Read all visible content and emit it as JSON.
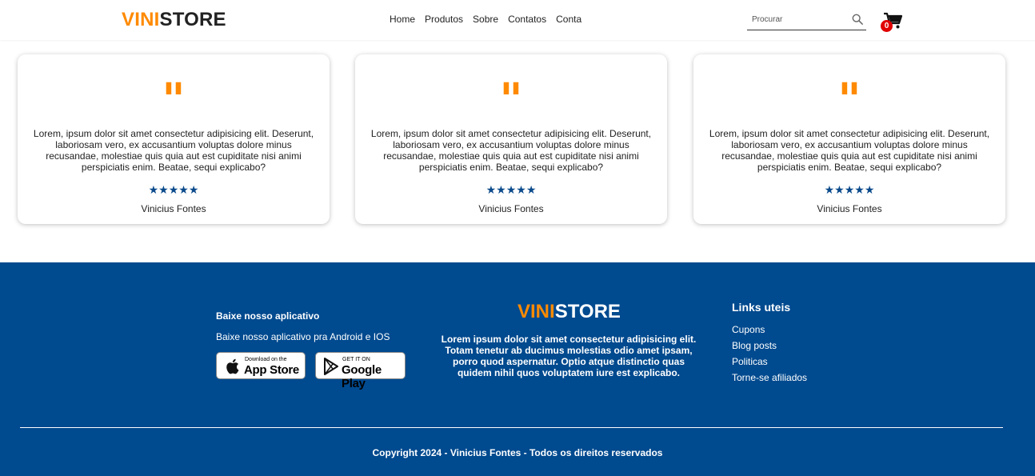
{
  "header": {
    "logo_part1": "VINI",
    "logo_part2": "STORE",
    "nav": [
      "Home",
      "Produtos",
      "Sobre",
      "Contatos",
      "Conta"
    ],
    "search_placeholder": "Procurar",
    "search_icon": "search-icon",
    "cart_icon": "cart-icon",
    "cart_count": "0"
  },
  "testimonials": [
    {
      "quote_mark": "\"",
      "text": "Lorem, ipsum dolor sit amet consectetur adipisicing elit. Deserunt, laboriosam vero, ex accusantium voluptas dolore minus recusandae, molestiae quis quia aut est cupiditate nisi animi perspiciatis enim. Beatae, sequi explicabo?",
      "stars": "★★★★★",
      "rating": 5,
      "author": "Vinicius Fontes"
    },
    {
      "quote_mark": "\"",
      "text": "Lorem, ipsum dolor sit amet consectetur adipisicing elit. Deserunt, laboriosam vero, ex accusantium voluptas dolore minus recusandae, molestiae quis quia aut est cupiditate nisi animi perspiciatis enim. Beatae, sequi explicabo?",
      "stars": "★★★★★",
      "rating": 5,
      "author": "Vinicius Fontes"
    },
    {
      "quote_mark": "\"",
      "text": "Lorem, ipsum dolor sit amet consectetur adipisicing elit. Deserunt, laboriosam vero, ex accusantium voluptas dolore minus recusandae, molestiae quis quia aut est cupiditate nisi animi perspiciatis enim. Beatae, sequi explicabo?",
      "stars": "★★★★★",
      "rating": 5,
      "author": "Vinicius Fontes"
    }
  ],
  "footer": {
    "app_title": "Baixe nosso aplicativo",
    "app_desc": "Baixe nosso aplicativo pra Android e IOS",
    "appstore_small": "Download on the",
    "appstore_big": "App Store",
    "googleplay_small": "GET IT ON",
    "googleplay_big": "Google Play",
    "logo_part1": "VINI",
    "logo_part2": "STORE",
    "description": "Lorem ipsum dolor sit amet consectetur adipisicing elit. Totam tenetur ab ducimus molestias odio amet ipsam, porro quod aspernatur. Optio atque distinctio quas quidem nihil quos voluptatem iure est explicabo.",
    "links_title": "Links uteis",
    "links": [
      "Cupons",
      "Blog posts",
      "Politicas",
      "Torne-se afiliados"
    ],
    "copyright": "Copyright 2024 - Vinicius Fontes - Todos os direitos reservados"
  },
  "colors": {
    "accent": "#ff8a00",
    "footer_bg": "#004a8f",
    "star": "#0b4a8b",
    "badge": "#e00000"
  }
}
